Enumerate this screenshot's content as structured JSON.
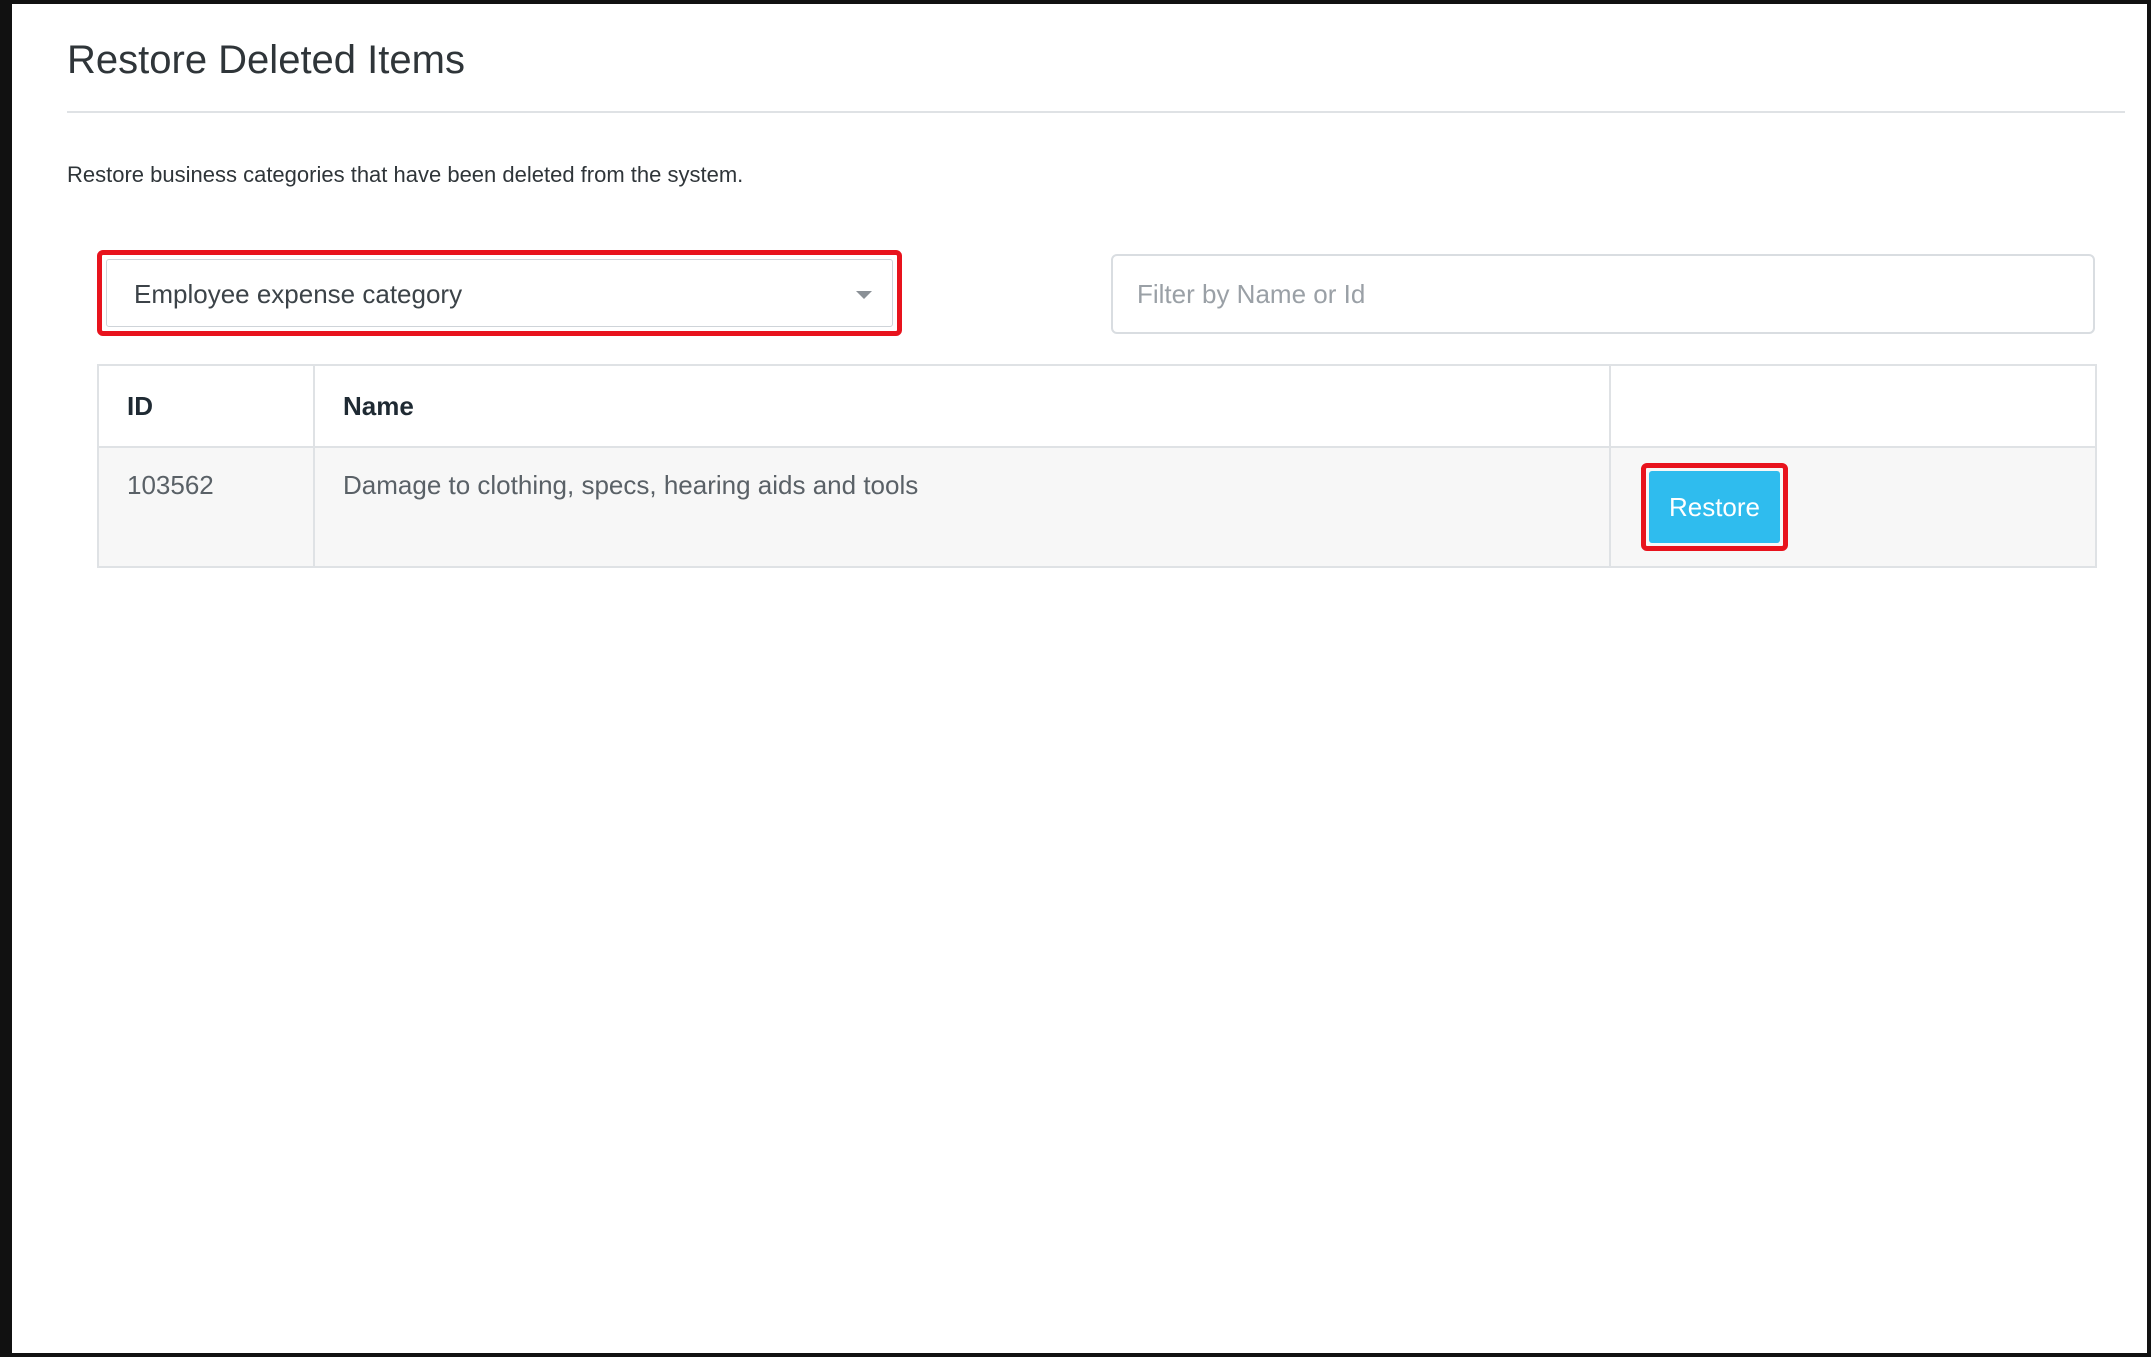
{
  "page": {
    "title": "Restore Deleted Items",
    "description": "Restore business categories that have been deleted from the system."
  },
  "category_select": {
    "selected": "Employee expense category",
    "icon": "chevron-down-icon"
  },
  "filter": {
    "value": "",
    "placeholder": "Filter by Name or Id"
  },
  "table": {
    "columns": [
      "ID",
      "Name",
      ""
    ],
    "rows": [
      {
        "id": "103562",
        "name": "Damage to clothing, specs, hearing aids and tools",
        "action_label": "Restore"
      }
    ]
  },
  "colors": {
    "accent": "#2fbcee",
    "highlight": "#e8131d",
    "border": "#dfe2e5",
    "row_background": "#f7f7f7"
  }
}
